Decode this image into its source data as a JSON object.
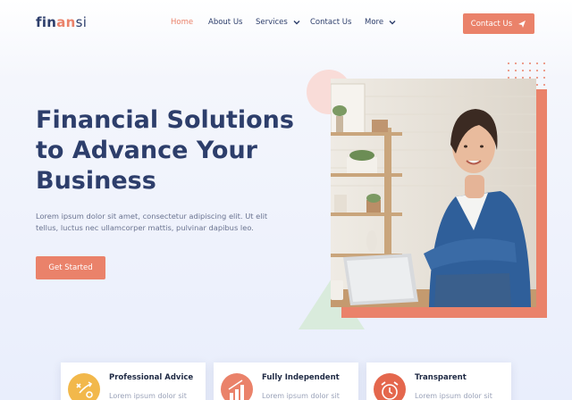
{
  "brand": {
    "part1": "fin",
    "part2": "an",
    "part3": "si"
  },
  "nav": {
    "items": [
      {
        "label": "Home",
        "active": true
      },
      {
        "label": "About Us",
        "active": false
      },
      {
        "label": "Services",
        "dropdown": true
      },
      {
        "label": "Contact Us",
        "active": false
      },
      {
        "label": "More",
        "dropdown": true
      }
    ],
    "cta_label": "Contact Us"
  },
  "hero": {
    "title_lines": [
      "Financial Solutions",
      "to Advance Your",
      "Business"
    ],
    "text_lines": [
      "Lorem ipsum dolor sit amet, consectetur adipiscing elit. Ut elit",
      "tellus, luctus nec ullamcorper mattis, pulvinar dapibus leo."
    ],
    "button_label": "Get Started"
  },
  "features": [
    {
      "title": "Professional Advice",
      "text": "Lorem ipsum dolor sit",
      "icon": "strategy-icon",
      "color": "#f2b84b"
    },
    {
      "title": "Fully Independent",
      "text": "Lorem ipsum dolor sit",
      "icon": "growth-chart-icon",
      "color": "#ea826a"
    },
    {
      "title": "Transparent",
      "text": "Lorem ipsum dolor sit",
      "icon": "alarm-clock-icon",
      "color": "#e4674d"
    }
  ],
  "colors": {
    "accent": "#ea826a",
    "navy": "#2d3e6b",
    "muted": "#6a7390"
  }
}
